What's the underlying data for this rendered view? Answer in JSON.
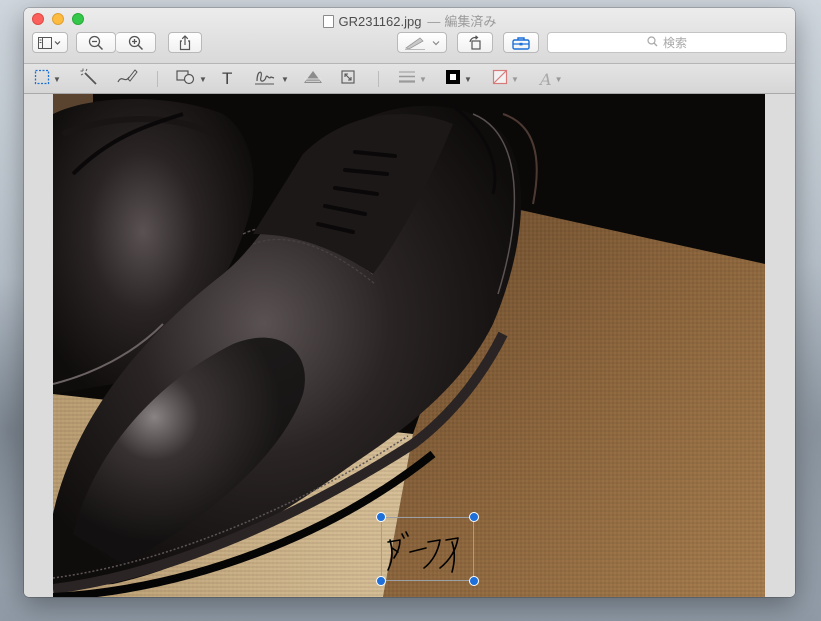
{
  "window": {
    "title": "GR231162.jpg",
    "separator": "—",
    "status": "編集済み"
  },
  "toolbar": {
    "buttons": [
      {
        "name": "sidebar-view-button",
        "icon": "sidebar-icon"
      },
      {
        "name": "zoom-out-button",
        "icon": "zoom-out-icon"
      },
      {
        "name": "zoom-in-button",
        "icon": "zoom-in-icon"
      },
      {
        "name": "share-button",
        "icon": "share-icon"
      },
      {
        "name": "pen-highlight-button",
        "icon": "pen-icon"
      },
      {
        "name": "rotate-button",
        "icon": "rotate-left-icon"
      },
      {
        "name": "markup-toolbox-button",
        "icon": "toolbox-icon",
        "active_color": "#1a6fd8"
      }
    ],
    "search": {
      "placeholder": "検索",
      "icon": "search-icon"
    }
  },
  "markup_toolbar": {
    "tools": [
      {
        "name": "rectangular-selection-tool",
        "icon": "dashed-rect-icon",
        "selected": true
      },
      {
        "name": "instant-alpha-tool",
        "icon": "magic-wand-icon"
      },
      {
        "name": "sketch-tool",
        "icon": "sketch-icon"
      },
      {
        "name": "shapes-tool",
        "icon": "shapes-icon"
      },
      {
        "name": "text-tool",
        "icon": "text-icon",
        "glyph": "T"
      },
      {
        "name": "signature-tool",
        "icon": "signature-icon"
      },
      {
        "name": "adjust-color-tool",
        "icon": "adjust-color-icon"
      },
      {
        "name": "adjust-size-tool",
        "icon": "resize-icon"
      },
      {
        "name": "shape-style-tool",
        "icon": "line-style-icon"
      },
      {
        "name": "border-color-tool",
        "icon": "border-color-icon",
        "color": "#000000"
      },
      {
        "name": "fill-color-tool",
        "icon": "fill-color-icon",
        "color": "#d77a7a"
      },
      {
        "name": "text-style-tool",
        "icon": "text-style-icon",
        "glyph": "A"
      }
    ]
  },
  "image": {
    "description_icon": "photo-of-black-oxford-shoes",
    "annotation": {
      "text": "ダークワ",
      "kind": "signature-sketch",
      "handle_color": "#1e6fd9"
    }
  }
}
